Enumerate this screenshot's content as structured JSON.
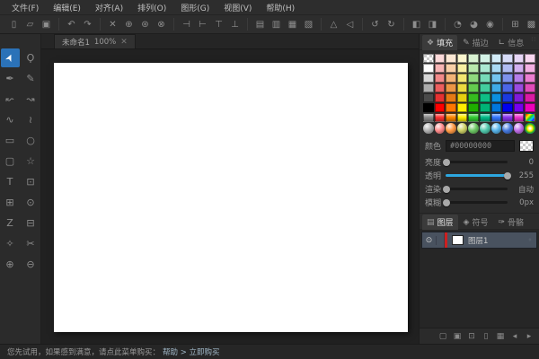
{
  "menubar": {
    "items": [
      "文件(F)",
      "编辑(E)",
      "对齐(A)",
      "排列(O)",
      "图形(G)",
      "视图(V)",
      "帮助(H)"
    ]
  },
  "toolbar": {
    "groups": [
      [
        {
          "name": "new-file-icon",
          "glyph": "▯"
        },
        {
          "name": "open-file-icon",
          "glyph": "▱"
        },
        {
          "name": "save-icon",
          "glyph": "▣"
        }
      ],
      [
        {
          "name": "undo-icon",
          "glyph": "↶"
        },
        {
          "name": "redo-icon",
          "glyph": "↷"
        }
      ],
      [
        {
          "name": "delete-icon",
          "glyph": "✕"
        },
        {
          "name": "copy-icon",
          "glyph": "⊕"
        },
        {
          "name": "clone-icon",
          "glyph": "⊛"
        },
        {
          "name": "trash-icon",
          "glyph": "⊗"
        }
      ],
      [
        {
          "name": "align-left-icon",
          "glyph": "⊣"
        },
        {
          "name": "align-right-icon",
          "glyph": "⊢"
        },
        {
          "name": "align-top-icon",
          "glyph": "⊤"
        },
        {
          "name": "align-bottom-icon",
          "glyph": "⊥"
        }
      ],
      [
        {
          "name": "group-icon",
          "glyph": "▤"
        },
        {
          "name": "ungroup-icon",
          "glyph": "▥"
        },
        {
          "name": "bring-front-icon",
          "glyph": "▦"
        },
        {
          "name": "send-back-icon",
          "glyph": "▧"
        }
      ],
      [
        {
          "name": "flip-vertical-icon",
          "glyph": "△"
        },
        {
          "name": "flip-horizontal-icon",
          "glyph": "◁"
        }
      ],
      [
        {
          "name": "rotate-left-icon",
          "glyph": "↺"
        },
        {
          "name": "rotate-right-icon",
          "glyph": "↻"
        }
      ],
      [
        {
          "name": "transform-icon",
          "glyph": "◧"
        },
        {
          "name": "skew-icon",
          "glyph": "◨"
        }
      ],
      [
        {
          "name": "union-icon",
          "glyph": "◔"
        },
        {
          "name": "intersect-icon",
          "glyph": "◕"
        },
        {
          "name": "subtract-icon",
          "glyph": "◉"
        }
      ],
      [
        {
          "name": "grid-toggle-icon",
          "glyph": "⊞"
        },
        {
          "name": "ruler-toggle-icon",
          "glyph": "▩"
        }
      ]
    ]
  },
  "tab": {
    "title": "未命名1",
    "zoom": "100%",
    "close_glyph": "✕"
  },
  "tools": [
    {
      "name": "select-tool",
      "glyph": "➤",
      "active": true,
      "cls": "rot-up"
    },
    {
      "name": "lasso-tool",
      "glyph": "Ϙ"
    },
    {
      "name": "node-edit-tool",
      "glyph": "✒"
    },
    {
      "name": "pencil-tool",
      "glyph": "✎"
    },
    {
      "name": "bend-left-tool",
      "glyph": "↜"
    },
    {
      "name": "bend-right-tool",
      "glyph": "↝"
    },
    {
      "name": "curve-tool",
      "glyph": "∿"
    },
    {
      "name": "wave-tool",
      "glyph": "≀"
    },
    {
      "name": "rectangle-tool",
      "glyph": "▭"
    },
    {
      "name": "ellipse-tool",
      "glyph": "○"
    },
    {
      "name": "speech-bubble-tool",
      "glyph": "▢"
    },
    {
      "name": "star-tool",
      "glyph": "☆"
    },
    {
      "name": "text-tool",
      "glyph": "T"
    },
    {
      "name": "image-tool",
      "glyph": "⊡"
    },
    {
      "name": "frame-tool",
      "glyph": "⊞"
    },
    {
      "name": "spiral-tool",
      "glyph": "⊙"
    },
    {
      "name": "zigzag-tool",
      "glyph": "Z"
    },
    {
      "name": "split-tool",
      "glyph": "⊟"
    },
    {
      "name": "dropper-tool",
      "glyph": "✧"
    },
    {
      "name": "knife-tool",
      "glyph": "✂"
    },
    {
      "name": "zoom-in-tool",
      "glyph": "⊕"
    },
    {
      "name": "zoom-out-tool",
      "glyph": "⊖"
    }
  ],
  "fill_panel": {
    "tabs": [
      {
        "label": "填充",
        "icon": "❖",
        "active": true,
        "name": "tab-fill"
      },
      {
        "label": "描边",
        "icon": "✎",
        "active": false,
        "name": "tab-stroke"
      },
      {
        "label": "信息",
        "icon": "∟",
        "active": false,
        "name": "tab-info"
      }
    ],
    "palette_flat_rows": [
      [
        "checker",
        "#fbd9d9",
        "#fbe7d4",
        "#fcf6cf",
        "#d9f2d2",
        "#d4f3e6",
        "#d3ecf8",
        "#d7dcf8",
        "#e7d7f6",
        "#f8d7f0"
      ],
      [
        "#ffffff",
        "#f7b5b5",
        "#f8cfa8",
        "#f8efa2",
        "#b8e8ac",
        "#abe9d2",
        "#a9daf4",
        "#b0bcf3",
        "#d2b0ef",
        "#f2b0e2"
      ],
      [
        "#d8d8d8",
        "#f28a8a",
        "#f2b377",
        "#f2e571",
        "#8fd97e",
        "#77dbb8",
        "#74c4ee",
        "#7e92ec",
        "#b57ee8",
        "#ea7ed0"
      ],
      [
        "#adadad",
        "#ec5f5f",
        "#eb9646",
        "#ebda40",
        "#64cb4f",
        "#43cd9e",
        "#3faae7",
        "#4c66e6",
        "#9a4ce0",
        "#e04cba"
      ],
      [
        "#4a4a4a",
        "#e63232",
        "#e67a15",
        "#e6cf10",
        "#36bc1f",
        "#0fbe85",
        "#0b90e0",
        "#1b39df",
        "#7f1bd9",
        "#d91ba4"
      ],
      [
        "#000000",
        "#ff0000",
        "#ff7700",
        "#ffee00",
        "#1faf00",
        "#00b376",
        "#0077dd",
        "#0000ee",
        "#7700ee",
        "#ee00bb"
      ]
    ],
    "gloss_row": [
      "#8a8a8a",
      "#ff3333",
      "#ff8800",
      "#ffee00",
      "#33cc33",
      "#00bb88",
      "#3377ff",
      "#8833ee",
      "#ee33cc",
      "rainbow"
    ],
    "sphere_row": [
      "#b0b0b0",
      "#ff8a8a",
      "#ff9944",
      "#cdd066",
      "#6cc663",
      "#4fc7ab",
      "#57b4ea",
      "#4477dd",
      "#c06ce8",
      "rainbow-ring"
    ],
    "color_label": "颜色",
    "color_value": "#00000000",
    "sliders": [
      {
        "name": "brightness-slider",
        "label": "亮度",
        "value": "0",
        "fill": 2
      },
      {
        "name": "opacity-slider",
        "label": "透明",
        "value": "255",
        "fill": 100
      },
      {
        "name": "render-slider",
        "label": "渲染",
        "value": "自动",
        "fill": 2
      },
      {
        "name": "blur-slider",
        "label": "模糊",
        "value": "0px",
        "fill": 2
      }
    ]
  },
  "layers_panel": {
    "tabs": [
      {
        "label": "图层",
        "icon": "▤",
        "active": true,
        "name": "tab-layers"
      },
      {
        "label": "符号",
        "icon": "◈",
        "active": false,
        "name": "tab-symbols"
      },
      {
        "label": "骨骼",
        "icon": "✑",
        "active": false,
        "name": "tab-bones"
      }
    ],
    "rows": [
      {
        "name": "图层1",
        "eye_glyph": "⊙",
        "bar_color": "#cc2020",
        "thumb_color": "#ffffff",
        "lock_glyph": "◦"
      }
    ],
    "footer_icons": [
      {
        "name": "add-layer-icon",
        "glyph": "▢"
      },
      {
        "name": "add-group-icon",
        "glyph": "▣"
      },
      {
        "name": "duplicate-layer-icon",
        "glyph": "⊡"
      },
      {
        "name": "delete-layer-icon",
        "glyph": "▯"
      },
      {
        "name": "layer-options-icon",
        "glyph": "▦"
      },
      {
        "name": "prev-layer-icon",
        "glyph": "◂"
      },
      {
        "name": "next-layer-icon",
        "glyph": "▸"
      }
    ]
  },
  "statusbar": {
    "text": "您先试用，如果感到满意，请点此菜单购买：",
    "link": "帮助 > 立即购买"
  },
  "colors": {
    "accent_blue": "#2da7e0",
    "tool_selected": "#2b72b8",
    "layer_selected": "#49525f"
  }
}
